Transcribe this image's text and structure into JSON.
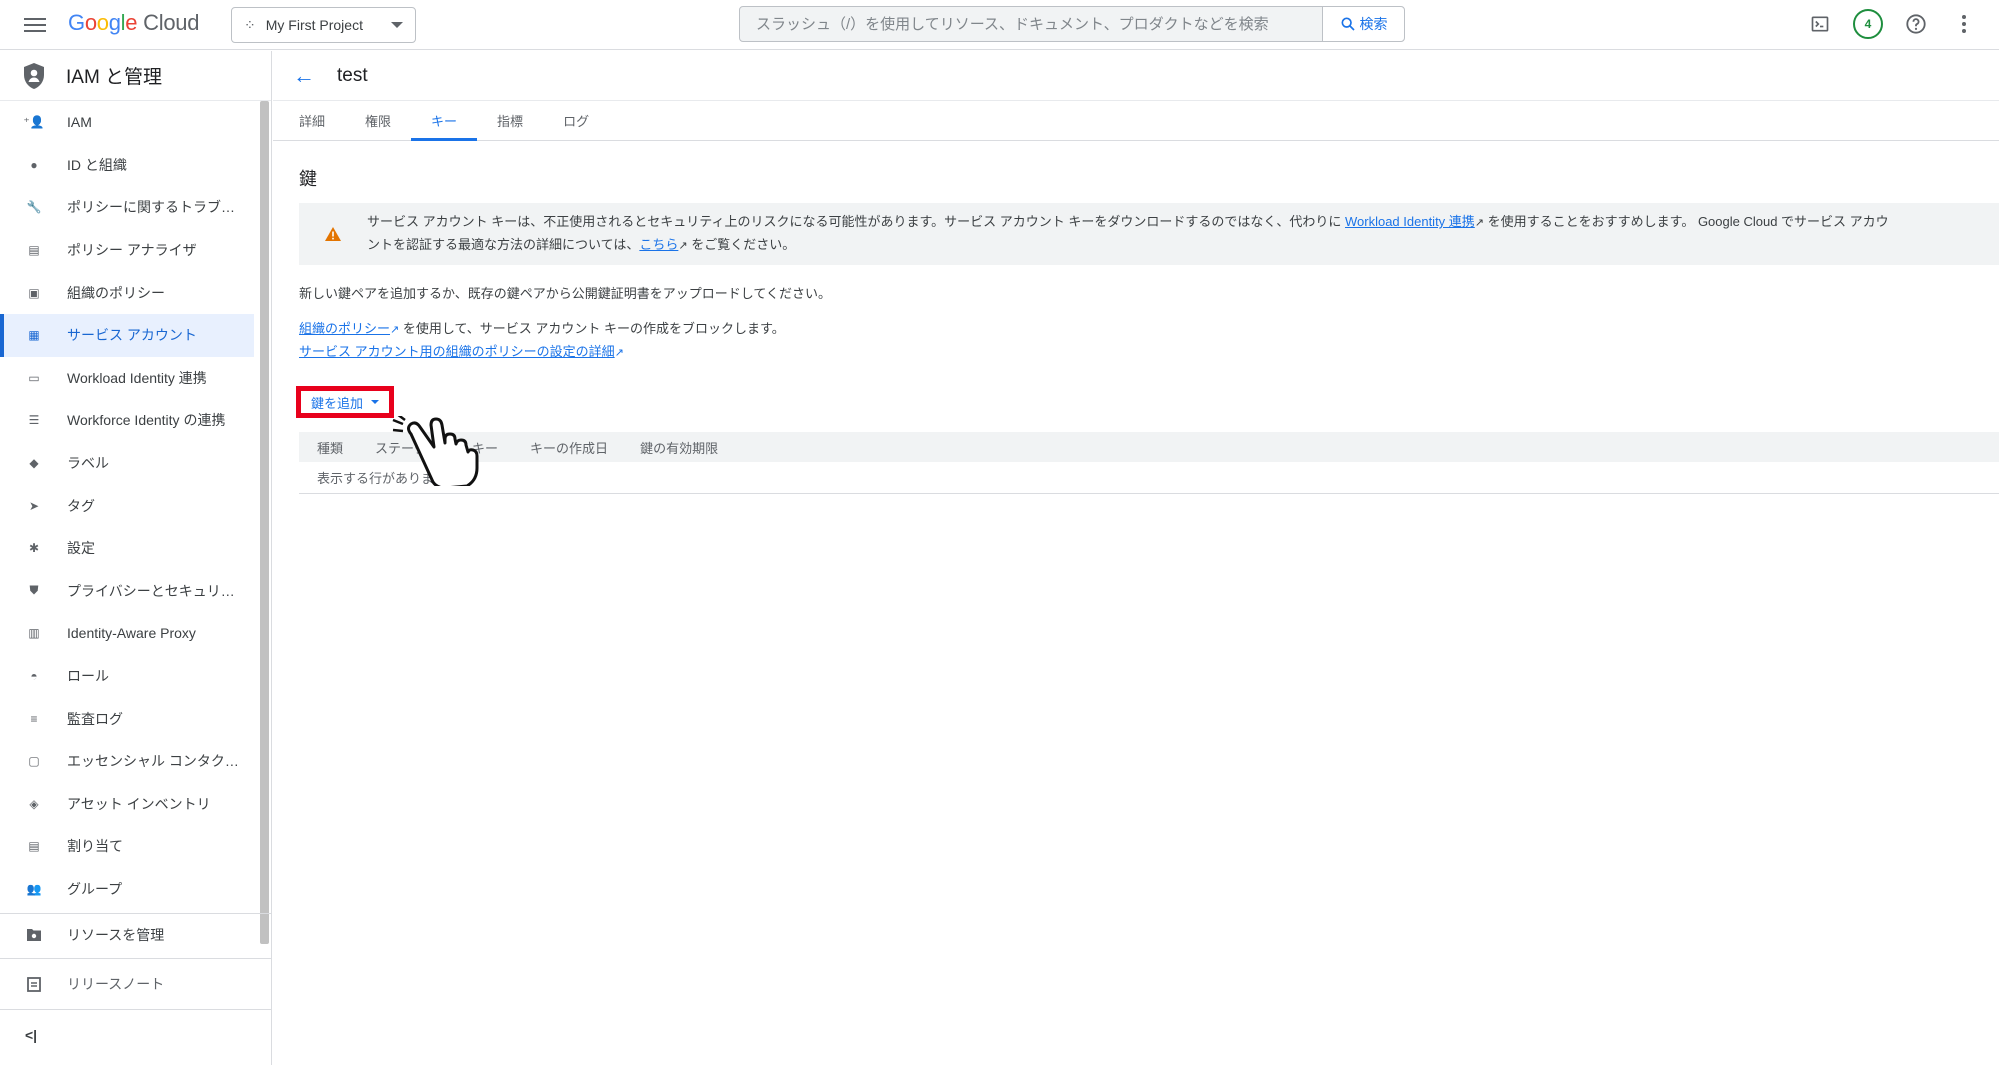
{
  "topbar": {
    "logo_google": "Google",
    "logo_cloud": "Cloud",
    "project": "My First Project",
    "search_placeholder": "スラッシュ（/）を使用してリソース、ドキュメント、プロダクトなどを検索",
    "search_button": "検索",
    "notifications_count": "4"
  },
  "sidebar": {
    "title": "IAM と管理",
    "items": [
      {
        "label": "IAM",
        "icon": "person-add-icon"
      },
      {
        "label": "ID と組織",
        "icon": "account-circle-icon"
      },
      {
        "label": "ポリシーに関するトラブ…",
        "icon": "wrench-icon"
      },
      {
        "label": "ポリシー アナライザ",
        "icon": "document-search-icon"
      },
      {
        "label": "組織のポリシー",
        "icon": "list-box-icon"
      },
      {
        "label": "サービス アカウント",
        "icon": "service-account-icon",
        "active": true
      },
      {
        "label": "Workload Identity 連携",
        "icon": "id-card-icon"
      },
      {
        "label": "Workforce Identity の連携",
        "icon": "list-icon"
      },
      {
        "label": "ラベル",
        "icon": "tag-icon"
      },
      {
        "label": "タグ",
        "icon": "chevron-tag-icon"
      },
      {
        "label": "設定",
        "icon": "gear-icon"
      },
      {
        "label": "プライバシーとセキュリ…",
        "icon": "shield-icon"
      },
      {
        "label": "Identity-Aware Proxy",
        "icon": "proxy-icon"
      },
      {
        "label": "ロール",
        "icon": "hat-icon"
      },
      {
        "label": "監査ログ",
        "icon": "lines-icon"
      },
      {
        "label": "エッセンシャル コンタク…",
        "icon": "contact-icon"
      },
      {
        "label": "アセット インベントリ",
        "icon": "diamond-icon"
      },
      {
        "label": "割り当て",
        "icon": "quota-icon"
      },
      {
        "label": "グループ",
        "icon": "group-icon"
      }
    ],
    "manage_resources": "リソースを管理",
    "release_notes": "リリースノート",
    "collapse": "<|"
  },
  "main": {
    "title": "test",
    "tabs": [
      "詳細",
      "権限",
      "キー",
      "指標",
      "ログ"
    ],
    "active_tab": "キー",
    "section_title": "鍵",
    "warning": {
      "line1_a": "サービス アカウント キーは、不正使用されるとセキュリティ上のリスクになる可能性があります。サービス アカウント キーをダウンロードするのではなく、代わりに ",
      "link1": "Workload Identity 連携",
      "line1_b": " を使用することをおすすめします。 Google Cloud でサービス アカウ",
      "line2_a": "ントを認証する最適な方法の詳細については、",
      "link2": "こちら",
      "line2_b": " をご覧ください。"
    },
    "description": "新しい鍵ペアを追加するか、既存の鍵ペアから公開鍵証明書をアップロードしてください。",
    "policy_link": "組織のポリシー",
    "policy_text": " を使用して、サービス アカウント キーの作成をブロックします。",
    "policy_detail_link": "サービス アカウント用の組織のポリシーの設定の詳細",
    "add_key": "鍵を追加",
    "table": {
      "columns": [
        "種類",
        "ステータス",
        "キー",
        "キーの作成日",
        "鍵の有効期限"
      ],
      "empty": "表示する行がありません"
    }
  }
}
